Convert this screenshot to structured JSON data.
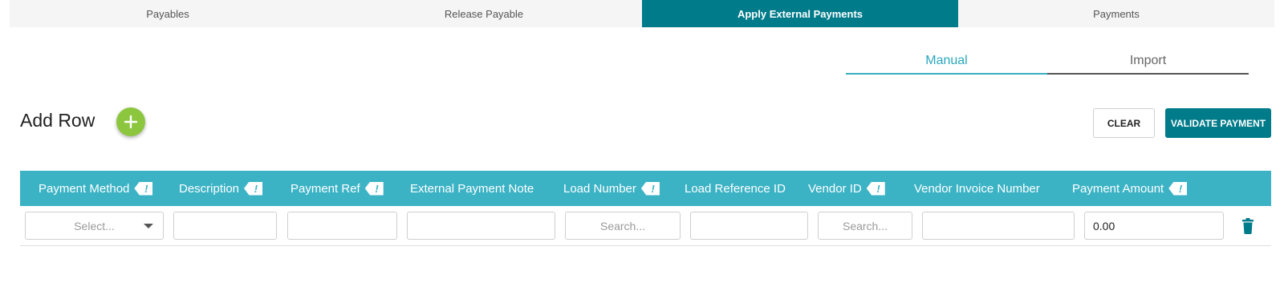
{
  "top_tabs": [
    {
      "label": "Payables"
    },
    {
      "label": "Release Payable"
    },
    {
      "label": "Apply External Payments"
    },
    {
      "label": "Payments"
    }
  ],
  "sub_tabs": [
    {
      "label": "Manual"
    },
    {
      "label": "Import"
    }
  ],
  "add_row": {
    "title": "Add Row"
  },
  "actions": {
    "clear_label": "CLEAR",
    "validate_label": "VALIDATE PAYMENT"
  },
  "table": {
    "columns": [
      {
        "label": "Payment Method",
        "required": true
      },
      {
        "label": "Description",
        "required": true
      },
      {
        "label": "Payment Ref",
        "required": true
      },
      {
        "label": "External Payment Note",
        "required": false
      },
      {
        "label": "Load Number",
        "required": true
      },
      {
        "label": "Load Reference ID",
        "required": false
      },
      {
        "label": "Vendor ID",
        "required": true
      },
      {
        "label": "Vendor Invoice Number",
        "required": false
      },
      {
        "label": "Payment Amount",
        "required": true
      }
    ],
    "required_marker": "!",
    "row": {
      "payment_method_placeholder": "Select...",
      "description": "",
      "payment_ref": "",
      "external_payment_note": "",
      "load_number_placeholder": "Search...",
      "load_reference_id": "",
      "vendor_id_placeholder": "Search...",
      "vendor_invoice_number": "",
      "payment_amount": "0.00"
    }
  },
  "colors": {
    "brand": "#007b8a",
    "header": "#3bb3c5",
    "add_button": "#8cc63f",
    "active_subtab": "#2aa7bd"
  },
  "icons": {
    "add": "plus-icon",
    "delete": "trash-icon",
    "dropdown": "chevron-down-icon",
    "required": "exclamation-tag-icon"
  }
}
